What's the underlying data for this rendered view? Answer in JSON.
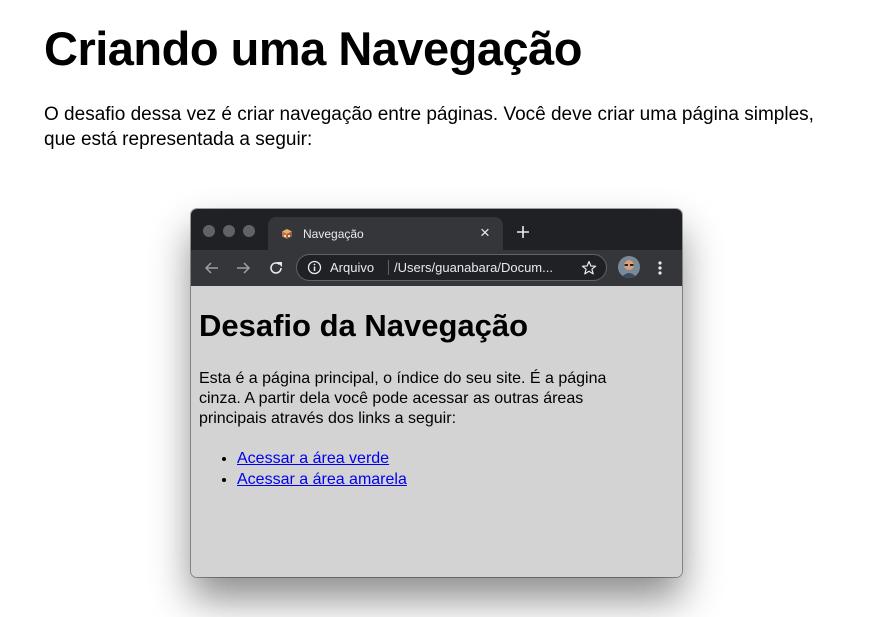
{
  "document": {
    "title": "Criando uma Navegação",
    "intro": "O desafio dessa vez é criar navegação entre páginas. Você deve criar uma página simples, que está representada a seguir:"
  },
  "browser": {
    "tab": {
      "title": "Navegação",
      "close_label": "×",
      "favicon": "cube-favicon-icon"
    },
    "toolbar": {
      "back_icon": "arrow-left-icon",
      "forward_icon": "arrow-right-icon",
      "reload_icon": "reload-icon",
      "site_info_label": "Arquivo",
      "url": "/Users/guanabara/Docum...",
      "bookmark_icon": "star-icon",
      "menu_icon": "kebab-menu-icon"
    },
    "colors": {
      "tabbar": "#202124",
      "toolbar": "#35363a",
      "content_bg": "#d3d3d3",
      "link": "#0000ee"
    }
  },
  "page": {
    "heading": "Desafio da Navegação",
    "paragraph": "Esta é a página principal, o índice do seu site. É a página cinza. A partir dela você pode acessar as outras áreas principais através dos links a seguir:",
    "links": [
      {
        "label": "Acessar a área verde"
      },
      {
        "label": "Acessar a área amarela"
      }
    ]
  }
}
